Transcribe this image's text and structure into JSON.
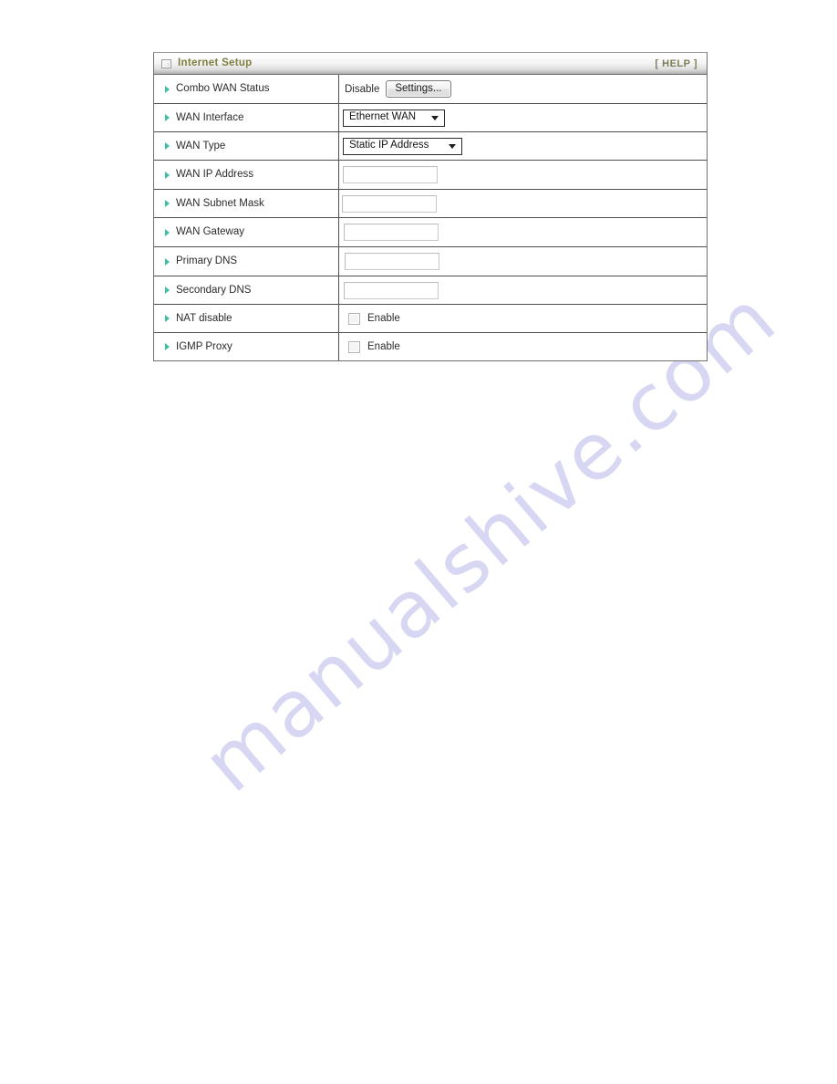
{
  "panel": {
    "title": "Internet Setup",
    "help_label": "[ HELP ]",
    "header_icon": "window-icon",
    "accent_title_color": "#7f7f3f",
    "accent_bullet_color": "#3fbfa4",
    "border_color": "#4f4f4f"
  },
  "rows": {
    "combo_wan_status": {
      "label": "Combo WAN Status",
      "status_text": "Disable",
      "button_label": "Settings..."
    },
    "wan_interface": {
      "label": "WAN Interface",
      "selected": "Ethernet WAN"
    },
    "wan_type": {
      "label": "WAN Type",
      "selected": "Static IP Address"
    },
    "wan_ip_address": {
      "label": "WAN IP Address",
      "value": "",
      "placeholder": ""
    },
    "wan_subnet_mask": {
      "label": "WAN Subnet Mask",
      "value": "",
      "placeholder": ""
    },
    "wan_gateway": {
      "label": "WAN Gateway",
      "value": "",
      "placeholder": ""
    },
    "primary_dns": {
      "label": "Primary DNS",
      "value": "",
      "placeholder": ""
    },
    "secondary_dns": {
      "label": "Secondary DNS",
      "value": "",
      "placeholder": ""
    },
    "nat_disable": {
      "label": "NAT disable",
      "checkbox_label": "Enable",
      "checked": false
    },
    "igmp_proxy": {
      "label": "IGMP Proxy",
      "checkbox_label": "Enable",
      "checked": false
    }
  },
  "watermark": {
    "text": "manualshive.com",
    "color": "#c9c9ef"
  }
}
